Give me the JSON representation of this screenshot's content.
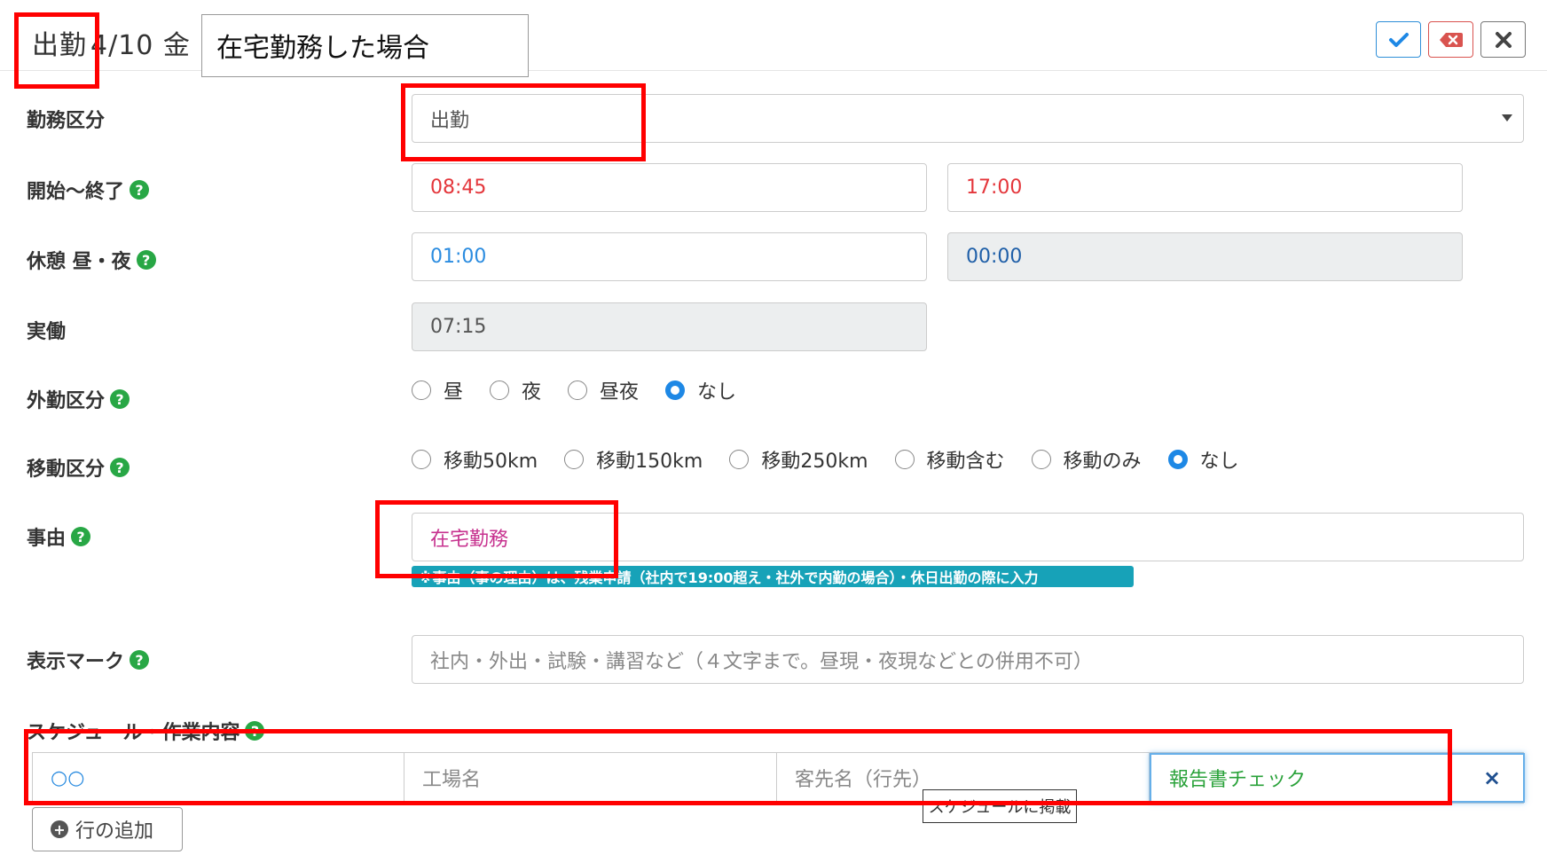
{
  "header": {
    "kubun": "出勤",
    "date": "4/10 金",
    "note": "在宅勤務した場合",
    "buttons": {
      "save": "check-icon",
      "delete": "delete-icon",
      "close": "close-icon"
    }
  },
  "form": {
    "kinmu_kubun": {
      "label": "勤務区分",
      "value": "出勤"
    },
    "start_end": {
      "label": "開始～終了",
      "start": "08:45",
      "end": "17:00"
    },
    "break": {
      "label": "休憩 昼・夜",
      "day": "01:00",
      "night": "00:00"
    },
    "actual": {
      "label": "実働",
      "value": "07:15"
    },
    "gaikin": {
      "label": "外勤区分",
      "options": [
        "昼",
        "夜",
        "昼夜",
        "なし"
      ],
      "selected": "なし"
    },
    "idou": {
      "label": "移動区分",
      "options": [
        "移動50km",
        "移動150km",
        "移動250km",
        "移動含む",
        "移動のみ",
        "なし"
      ],
      "selected": "なし"
    },
    "jiyuu": {
      "label": "事由",
      "value": "在宅勤務",
      "note": "※事由（事の理由）は、残業申請（社内で19:00超え・社外で内勤の場合）・休日出勤の際に入力"
    },
    "mark": {
      "label": "表示マーク",
      "placeholder": "社内・外出・試験・講習など（４文字まで。昼現・夜現などとの併用不可）"
    },
    "schedule": {
      "label": "スケジュール・作業内容",
      "row": {
        "cell1": "○○",
        "cell2_placeholder": "工場名",
        "cell3_placeholder": "客先名（行先）",
        "cell4": "報告書チェック"
      },
      "tooltip": "スケジュールに掲載",
      "add_row": "行の追加"
    }
  },
  "colors": {
    "highlight": "#ff0000",
    "help": "#28a745",
    "radio_on": "#1e88e5",
    "note_bg": "#17a2b8"
  }
}
